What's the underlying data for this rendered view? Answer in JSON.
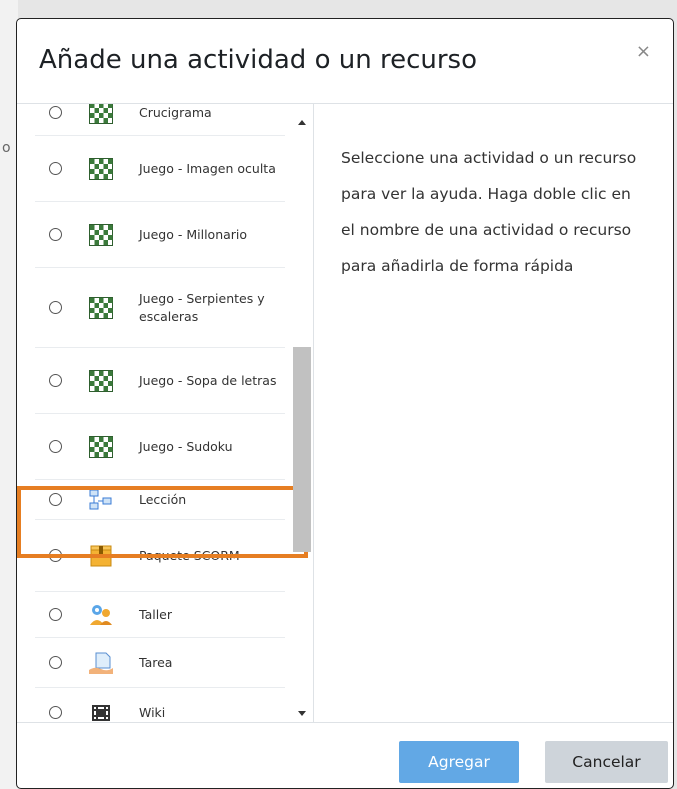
{
  "backdrop": {
    "fragment": "o"
  },
  "modal": {
    "title": "Añade una actividad o un recurso",
    "close_label": "×"
  },
  "list": {
    "items": [
      {
        "label": "Crucigrama",
        "icon": "game-grid-icon"
      },
      {
        "label": "Juego - Imagen oculta",
        "icon": "game-grid-icon"
      },
      {
        "label": "Juego - Millonario",
        "icon": "game-grid-icon"
      },
      {
        "label": "Juego - Serpientes y escaleras",
        "icon": "game-grid-icon"
      },
      {
        "label": "Juego - Sopa de letras",
        "icon": "game-grid-icon"
      },
      {
        "label": "Juego - Sudoku",
        "icon": "game-grid-icon",
        "highlighted": true
      },
      {
        "label": "Lección",
        "icon": "lesson-flowchart-icon"
      },
      {
        "label": "Paquete SCORM",
        "icon": "scorm-package-icon"
      },
      {
        "label": "Taller",
        "icon": "workshop-people-icon"
      },
      {
        "label": "Tarea",
        "icon": "assignment-hand-icon"
      },
      {
        "label": "Wiki",
        "icon": "wiki-knot-icon"
      }
    ]
  },
  "help": {
    "text": "Seleccione una actividad o un recurso para ver la ayuda. Haga doble clic en el nombre de una actividad o recurso para añadirla de forma rápida"
  },
  "footer": {
    "add_label": "Agregar",
    "cancel_label": "Cancelar"
  },
  "colors": {
    "primary": "#62a8e5",
    "secondary": "#ced4da",
    "highlight": "#e67e22"
  }
}
